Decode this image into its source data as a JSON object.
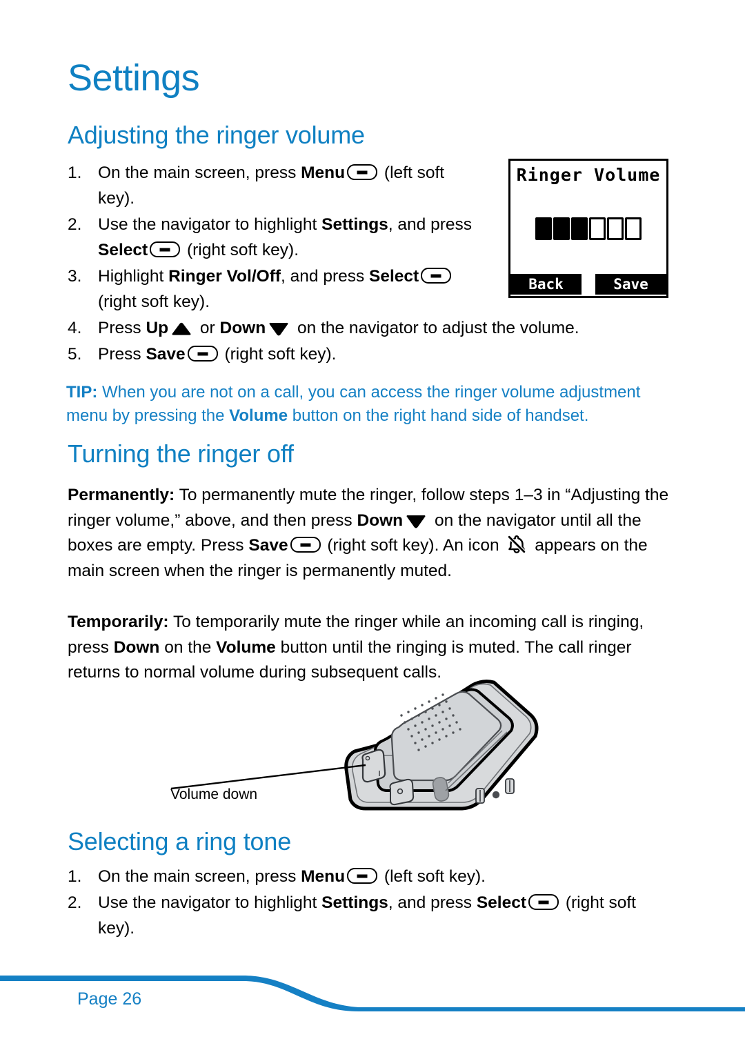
{
  "document": {
    "chapter_title": "Settings",
    "accent_color": "#0f80c2",
    "page_label": "Page 26"
  },
  "sections": {
    "adjusting": {
      "heading": "Adjusting the ringer volume",
      "steps": [
        {
          "num": "1.",
          "parts": [
            {
              "t": "On the main screen, press ",
              "b": false
            },
            {
              "t": "Menu",
              "b": true
            },
            {
              "icon": "softkey"
            },
            {
              "t": " (left soft key).",
              "b": false
            }
          ]
        },
        {
          "num": "2.",
          "parts": [
            {
              "t": "Use the navigator to highlight ",
              "b": false
            },
            {
              "t": "Settings",
              "b": true
            },
            {
              "t": ", and press ",
              "b": false
            },
            {
              "t": "Select",
              "b": true
            },
            {
              "icon": "softkey"
            },
            {
              "t": " (right soft key).",
              "b": false
            }
          ]
        },
        {
          "num": "3.",
          "parts": [
            {
              "t": "Highlight ",
              "b": false
            },
            {
              "t": "Ringer Vol/Off",
              "b": true
            },
            {
              "t": ", and press ",
              "b": false
            },
            {
              "t": "Select",
              "b": true
            },
            {
              "icon": "softkey"
            },
            {
              "t": " (right soft key).",
              "b": false
            }
          ]
        },
        {
          "num": "4.",
          "parts": [
            {
              "t": "Press ",
              "b": false
            },
            {
              "t": "Up",
              "b": true
            },
            {
              "icon": "nav-up"
            },
            {
              "t": " or ",
              "b": false
            },
            {
              "t": "Down",
              "b": true
            },
            {
              "icon": "nav-down"
            },
            {
              "t": " on the navigator to adjust the volume.",
              "b": false
            }
          ]
        },
        {
          "num": "5.",
          "parts": [
            {
              "t": "Press ",
              "b": false
            },
            {
              "t": "Save",
              "b": true
            },
            {
              "icon": "softkey"
            },
            {
              "t": " (right soft key).",
              "b": false
            }
          ]
        }
      ]
    },
    "tip": {
      "label": "TIP:",
      "text_1": " When you are not on a call, you can access the ringer volume adjustment menu by pressing the ",
      "bold_word": "Volume",
      "text_2": " button on the right hand side of handset."
    },
    "turning_off": {
      "heading": "Turning the ringer off",
      "permanently": {
        "label": "Permanently:",
        "t1": " To permanently  mute the ringer, follow steps 1–3 in “Adjusting the ringer volume,” above, and then press ",
        "b1": "Down",
        "t2": " on the navigator until all the boxes are empty. Press ",
        "b2": "Save",
        "t3": " (right soft key). An icon ",
        "t4": " appears on the main screen when the ringer is permanently muted."
      },
      "temporarily": {
        "label": "Temporarily:",
        "t1": " To temporarily mute the ringer while an incoming call is ringing, press ",
        "b1": "Down",
        "t2": " on the ",
        "b2": "Volume",
        "t3": " button until the ringing is muted. The call ringer returns to normal volume during subsequent calls."
      }
    },
    "ring_tone": {
      "heading": "Selecting a ring tone",
      "steps": [
        {
          "num": "1.",
          "parts": [
            {
              "t": "On the main screen, press ",
              "b": false
            },
            {
              "t": "Menu",
              "b": true
            },
            {
              "icon": "softkey"
            },
            {
              "t": " (left soft key).",
              "b": false
            }
          ]
        },
        {
          "num": "2.",
          "parts": [
            {
              "t": "Use the navigator to highlight ",
              "b": false
            },
            {
              "t": "Settings",
              "b": true
            },
            {
              "t": ", and press ",
              "b": false
            },
            {
              "t": "Select",
              "b": true
            },
            {
              "icon": "softkey"
            },
            {
              "t": " (right soft key).",
              "b": false
            }
          ]
        }
      ]
    }
  },
  "lcd_screen": {
    "title": "Ringer Volume",
    "volume_boxes_total": 6,
    "volume_boxes_filled": 3,
    "left_softkey": "Back",
    "right_softkey": "Save"
  },
  "illustration": {
    "callout_label": "Volume down"
  }
}
